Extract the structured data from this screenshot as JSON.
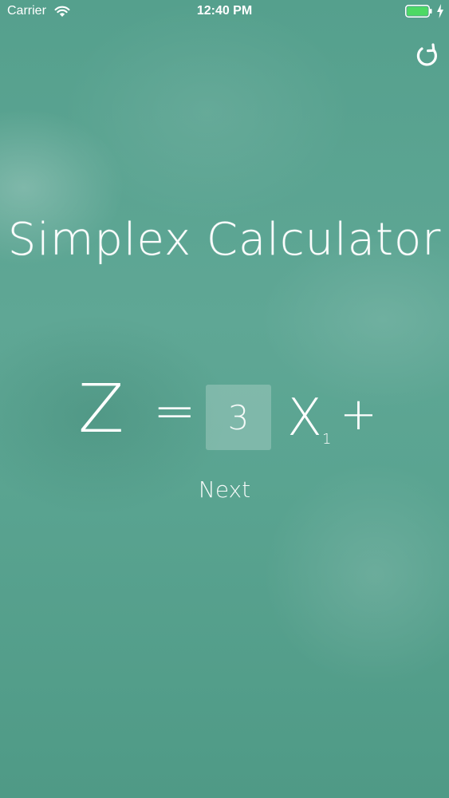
{
  "status_bar": {
    "carrier": "Carrier",
    "time": "12:40 PM"
  },
  "icons": {
    "wifi": "wifi-icon",
    "battery": "battery-icon",
    "charging": "charging-bolt-icon",
    "reset": "reset-icon"
  },
  "colors": {
    "background": "#55a08d",
    "battery_fill": "#4cd964",
    "text": "#ffffff"
  },
  "title": "Simplex Calculator",
  "equation": {
    "lhs": "Z",
    "equals": "=",
    "coefficient": "3",
    "variable": "X",
    "subscript": "1",
    "operator": "+"
  },
  "next_label": "Next"
}
